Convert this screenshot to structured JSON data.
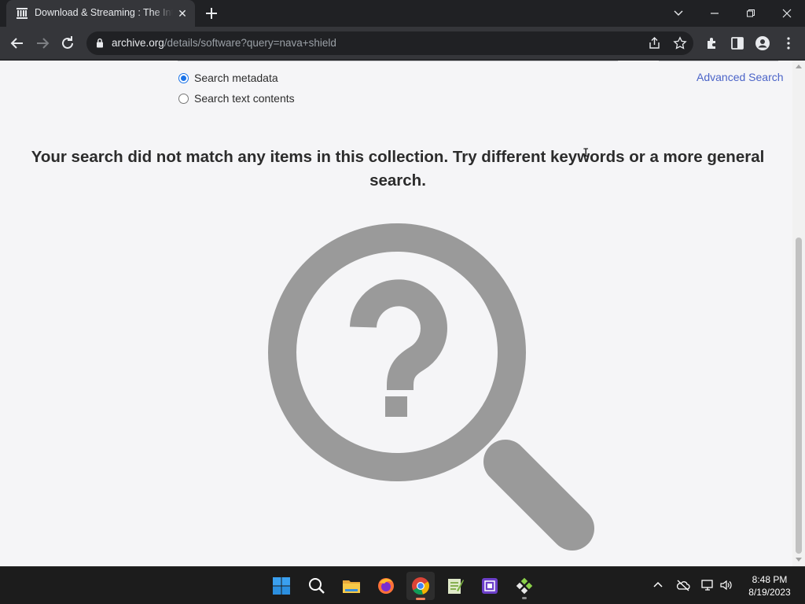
{
  "browser": {
    "tab": {
      "title": "Download & Streaming : The Internet Archive",
      "favicon": "archive-building-icon"
    },
    "address": {
      "host": "archive.org",
      "path": "/details/software?query=nava+shield"
    }
  },
  "page": {
    "search_options": [
      {
        "label": "Search metadata",
        "checked": true
      },
      {
        "label": "Search text contents",
        "checked": false
      }
    ],
    "advanced_search": "Advanced Search",
    "message": "Your search did not match any items in this collection. Try different keywords or a more general search.",
    "illustration": "magnifier-question-icon"
  },
  "taskbar": {
    "apps": [
      "windows-start-icon",
      "search-icon",
      "file-explorer-icon",
      "firefox-icon",
      "chrome-icon",
      "notepad-plus-plus-icon",
      "cpu-app-icon",
      "game-app-icon"
    ],
    "time": "8:48 PM",
    "date": "8/19/2023"
  },
  "colors": {
    "link": "#4b64c8",
    "radio_checked": "#1a73e8",
    "illustration": "#9a9a9a",
    "chrome_active_indicator": "#f0845e"
  }
}
